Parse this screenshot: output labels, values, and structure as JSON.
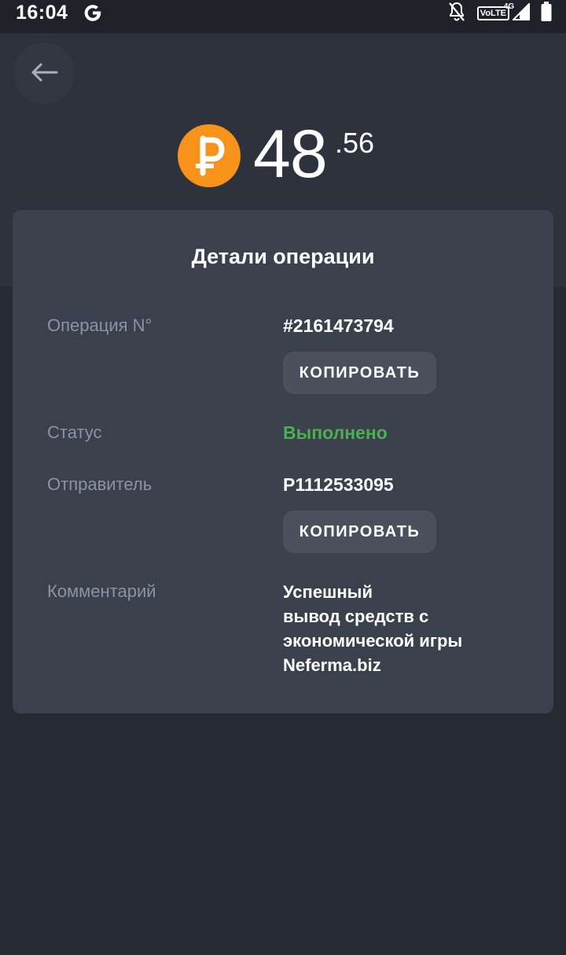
{
  "status_bar": {
    "time": "16:04",
    "volte_label": "VoLTE",
    "network_label": "4G"
  },
  "header": {
    "amount_integer": "48",
    "amount_fraction": ".56",
    "currency_icon": "ruble-coin-icon",
    "accent_color": "#f7931a"
  },
  "details": {
    "title": "Детали операции",
    "operation_label": "Операция N°",
    "operation_value": "#2161473794",
    "copy_label": "КОПИРОВАТЬ",
    "status_label": "Статус",
    "status_value": "Выполнено",
    "status_color": "#4caf50",
    "sender_label": "Отправитель",
    "sender_value": "P1112533095",
    "comment_label": "Комментарий",
    "comment_lines": [
      "Успешный",
      "вывод средств с",
      "экономической игры",
      "Neferma.biz"
    ]
  }
}
